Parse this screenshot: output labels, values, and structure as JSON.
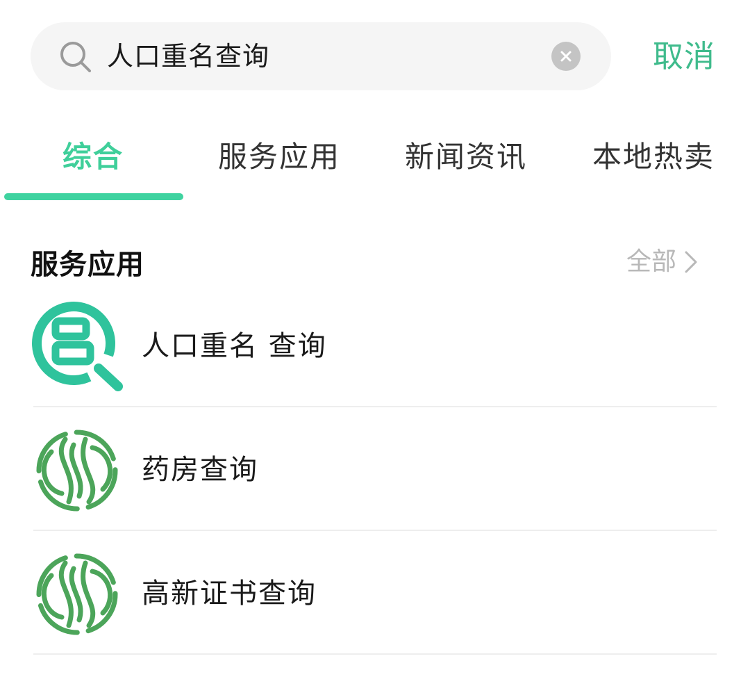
{
  "search": {
    "query": "人口重名查询",
    "cancel_label": "取消"
  },
  "tabs": [
    {
      "label": "综合",
      "active": true
    },
    {
      "label": "服务应用",
      "active": false
    },
    {
      "label": "新闻资讯",
      "active": false
    },
    {
      "label": "本地热卖",
      "active": false
    }
  ],
  "section": {
    "title": "服务应用",
    "see_all_label": "全部"
  },
  "results": [
    {
      "label": "人口重名 查询",
      "icon": "name-search-icon"
    },
    {
      "label": "药房查询",
      "icon": "service-emblem-icon"
    },
    {
      "label": "高新证书查询",
      "icon": "service-emblem-icon"
    }
  ],
  "colors": {
    "accent": "#3fcf9a",
    "icon_green": "#2fc39c",
    "emblem_green": "#4ca55a",
    "muted": "#b8b8b8"
  }
}
